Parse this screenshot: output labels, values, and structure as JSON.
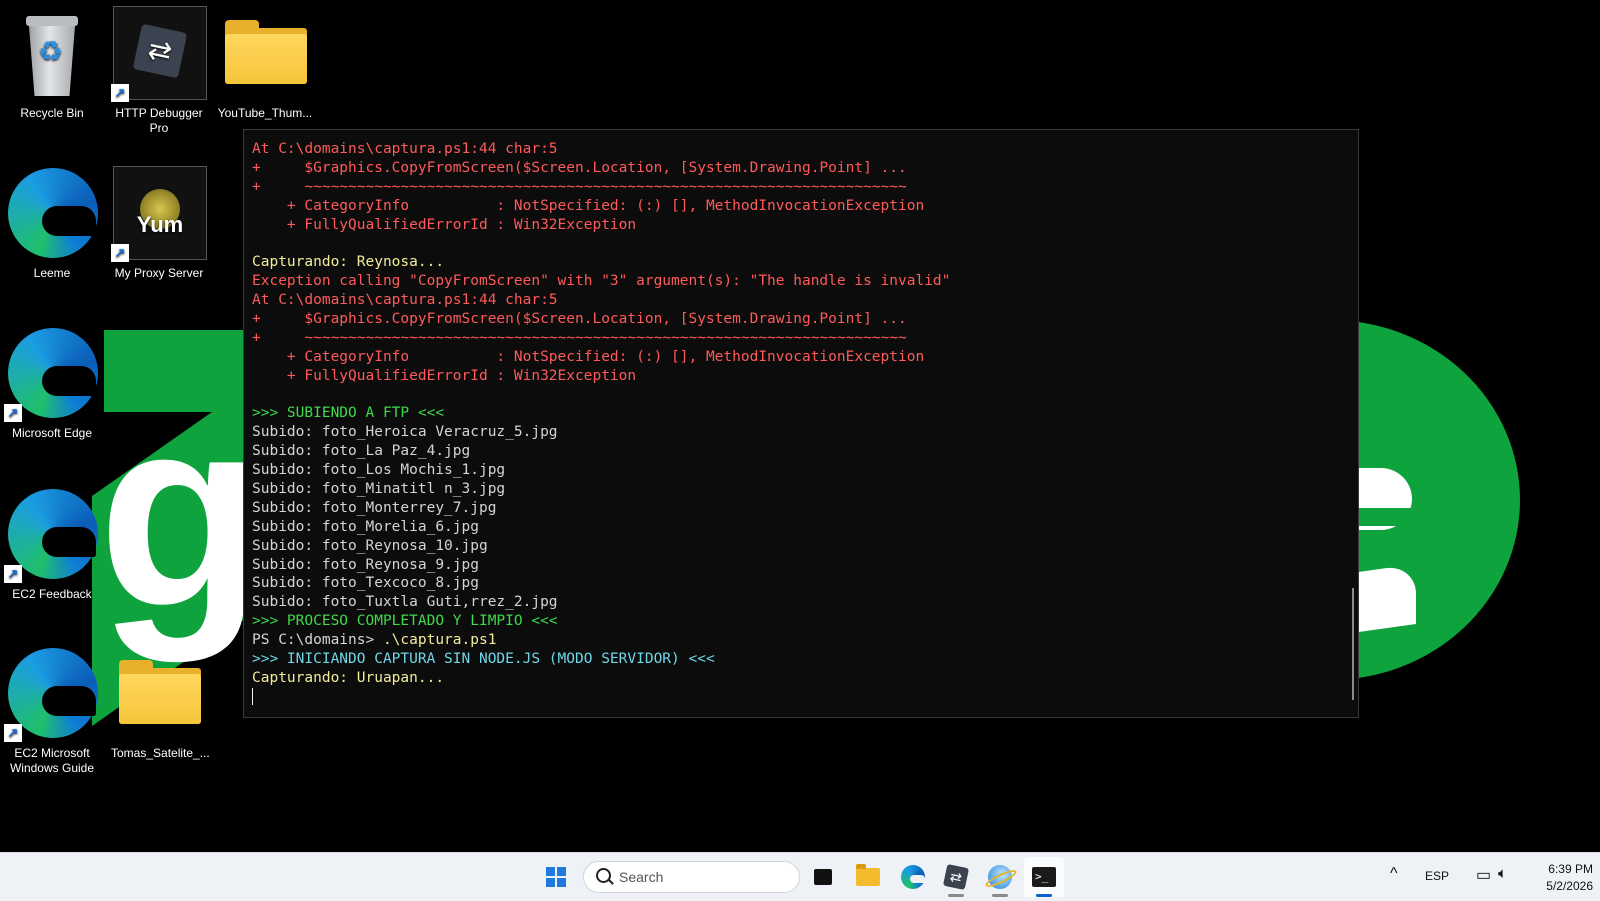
{
  "desktop": {
    "icons": [
      {
        "label": "Recycle Bin",
        "icon": "recycle-bin-icon",
        "shortcut": false
      },
      {
        "label": "HTTP Debugger Pro",
        "icon": "http-debugger-icon",
        "shortcut": true
      },
      {
        "label": "YouTube_Thum...",
        "icon": "folder-icon",
        "shortcut": false
      },
      {
        "label": "Leeme",
        "icon": "edge-icon",
        "shortcut": false
      },
      {
        "label": "My Proxy Server",
        "icon": "yum-icon",
        "shortcut": true,
        "logo_text": "Yum"
      },
      {
        "label": "Microsoft Edge",
        "icon": "edge-icon",
        "shortcut": true
      },
      {
        "label": "EC2 Feedback",
        "icon": "edge-icon",
        "shortcut": true
      },
      {
        "label": "EC2 Microsoft Windows Guide",
        "icon": "edge-icon",
        "shortcut": true
      },
      {
        "label": "Tomas_Satelite_...",
        "icon": "folder-icon",
        "shortcut": false
      }
    ],
    "wallpaper_letters": [
      "g",
      "e"
    ],
    "wallpaper_colors": {
      "green": "#0ea33d",
      "white": "#ffffff",
      "background": "#000000"
    }
  },
  "terminal": {
    "lines": [
      {
        "text": "At C:\\domains\\captura.ps1:44 char:5",
        "color": "red"
      },
      {
        "text": "+     $Graphics.CopyFromScreen($Screen.Location, [System.Drawing.Point] ...",
        "color": "red"
      },
      {
        "text": "+     ~~~~~~~~~~~~~~~~~~~~~~~~~~~~~~~~~~~~~~~~~~~~~~~~~~~~~~~~~~~~~~~~~~~~~",
        "color": "red"
      },
      {
        "text": "    + CategoryInfo          : NotSpecified: (:) [], MethodInvocationException",
        "color": "red"
      },
      {
        "text": "    + FullyQualifiedErrorId : Win32Exception",
        "color": "red"
      },
      {
        "text": "",
        "color": "white"
      },
      {
        "text": "Capturando: Reynosa...",
        "color": "yellow"
      },
      {
        "text": "Exception calling \"CopyFromScreen\" with \"3\" argument(s): \"The handle is invalid\"",
        "color": "red"
      },
      {
        "text": "At C:\\domains\\captura.ps1:44 char:5",
        "color": "red"
      },
      {
        "text": "+     $Graphics.CopyFromScreen($Screen.Location, [System.Drawing.Point] ...",
        "color": "red"
      },
      {
        "text": "+     ~~~~~~~~~~~~~~~~~~~~~~~~~~~~~~~~~~~~~~~~~~~~~~~~~~~~~~~~~~~~~~~~~~~~~",
        "color": "red"
      },
      {
        "text": "    + CategoryInfo          : NotSpecified: (:) [], MethodInvocationException",
        "color": "red"
      },
      {
        "text": "    + FullyQualifiedErrorId : Win32Exception",
        "color": "red"
      },
      {
        "text": "",
        "color": "white"
      },
      {
        "text": ">>> SUBIENDO A FTP <<<",
        "color": "green"
      },
      {
        "text": "Subido: foto_Heroica Veracruz_5.jpg",
        "color": "white"
      },
      {
        "text": "Subido: foto_La Paz_4.jpg",
        "color": "white"
      },
      {
        "text": "Subido: foto_Los Mochis_1.jpg",
        "color": "white"
      },
      {
        "text": "Subido: foto_Minatitl n_3.jpg",
        "color": "white"
      },
      {
        "text": "Subido: foto_Monterrey_7.jpg",
        "color": "white"
      },
      {
        "text": "Subido: foto_Morelia_6.jpg",
        "color": "white"
      },
      {
        "text": "Subido: foto_Reynosa_10.jpg",
        "color": "white"
      },
      {
        "text": "Subido: foto_Reynosa_9.jpg",
        "color": "white"
      },
      {
        "text": "Subido: foto_Texcoco_8.jpg",
        "color": "white"
      },
      {
        "text": "Subido: foto_Tuxtla Guti,rrez_2.jpg",
        "color": "white"
      },
      {
        "text": ">>> PROCESO COMPLETADO Y LIMPIO <<<",
        "color": "green"
      },
      {
        "text": "PS C:\\domains> .\\captura.ps1",
        "color": "fg",
        "prompt": "PS C:\\domains> ",
        "command": ".\\captura.ps1"
      },
      {
        "text": ">>> INICIANDO CAPTURA SIN NODE.JS (MODO SERVIDOR) <<<",
        "color": "cyan"
      },
      {
        "text": "Capturando: Uruapan...",
        "color": "yellow"
      }
    ],
    "colors": {
      "red": "#ff5a5a",
      "yellow": "#f2ec9b",
      "green": "#3fd94a",
      "cyan": "#6fd7e8",
      "white": "#d4d4d4",
      "fg": "#f2f2f2",
      "background": "#0c0c0c"
    }
  },
  "taskbar": {
    "start_icon": "windows-start-icon",
    "search_placeholder": "Search",
    "apps": [
      {
        "name": "task-view",
        "icon": "task-view-icon",
        "active": false,
        "open": false
      },
      {
        "name": "file-explorer",
        "icon": "file-explorer-icon",
        "active": false,
        "open": false
      },
      {
        "name": "edge",
        "icon": "edge-icon",
        "active": false,
        "open": false
      },
      {
        "name": "http-debugger",
        "icon": "http-debugger-icon",
        "active": false,
        "open": true
      },
      {
        "name": "internet-explorer",
        "icon": "internet-explorer-icon",
        "active": false,
        "open": true
      },
      {
        "name": "terminal",
        "icon": "terminal-icon",
        "active": true,
        "open": true
      }
    ],
    "tray": {
      "chevron": "^",
      "language": "ESP",
      "time": "6:39 PM",
      "date": "5/2/2026"
    },
    "accent": "#0a5fd1"
  }
}
